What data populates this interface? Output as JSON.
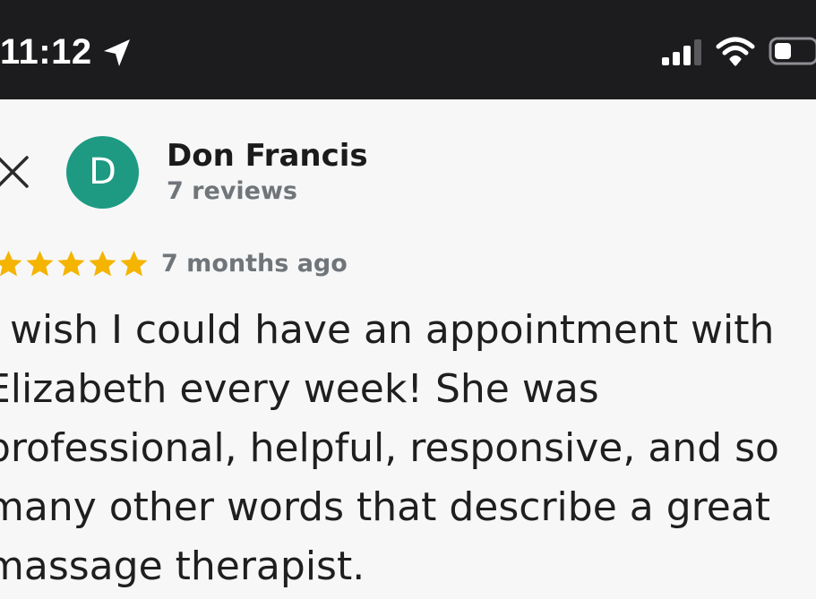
{
  "status_bar": {
    "time": "11:12",
    "icons": [
      "location-arrow-icon",
      "cellular-signal-icon",
      "wifi-icon",
      "battery-icon"
    ]
  },
  "review_header": {
    "close_icon": "close-icon",
    "avatar_letter": "D",
    "avatar_color": "#1e9a83",
    "reviewer_name": "Don Francis",
    "review_count": "7 reviews"
  },
  "review": {
    "rating": 5,
    "max_rating": 5,
    "star_color": "#f4b400",
    "date": "7 months ago",
    "text_lines": [
      "I wish I could have an appointment with",
      "Elizabeth every week! She was",
      "professional, helpful, responsive, and so",
      "many other words that describe a great",
      "massage therapist."
    ]
  }
}
